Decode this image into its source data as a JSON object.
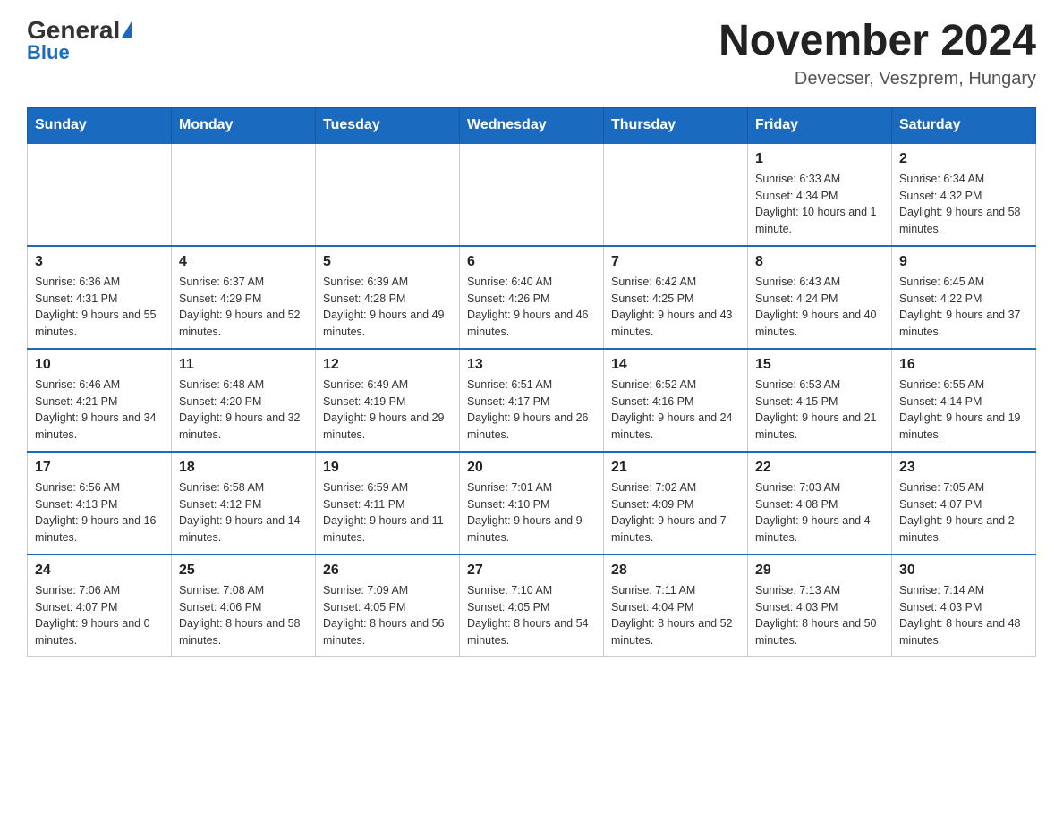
{
  "header": {
    "logo": {
      "general": "General",
      "blue": "Blue"
    },
    "title": "November 2024",
    "location": "Devecser, Veszprem, Hungary"
  },
  "calendar": {
    "days_of_week": [
      "Sunday",
      "Monday",
      "Tuesday",
      "Wednesday",
      "Thursday",
      "Friday",
      "Saturday"
    ],
    "weeks": [
      [
        {
          "day": "",
          "info": ""
        },
        {
          "day": "",
          "info": ""
        },
        {
          "day": "",
          "info": ""
        },
        {
          "day": "",
          "info": ""
        },
        {
          "day": "",
          "info": ""
        },
        {
          "day": "1",
          "info": "Sunrise: 6:33 AM\nSunset: 4:34 PM\nDaylight: 10 hours and 1 minute."
        },
        {
          "day": "2",
          "info": "Sunrise: 6:34 AM\nSunset: 4:32 PM\nDaylight: 9 hours and 58 minutes."
        }
      ],
      [
        {
          "day": "3",
          "info": "Sunrise: 6:36 AM\nSunset: 4:31 PM\nDaylight: 9 hours and 55 minutes."
        },
        {
          "day": "4",
          "info": "Sunrise: 6:37 AM\nSunset: 4:29 PM\nDaylight: 9 hours and 52 minutes."
        },
        {
          "day": "5",
          "info": "Sunrise: 6:39 AM\nSunset: 4:28 PM\nDaylight: 9 hours and 49 minutes."
        },
        {
          "day": "6",
          "info": "Sunrise: 6:40 AM\nSunset: 4:26 PM\nDaylight: 9 hours and 46 minutes."
        },
        {
          "day": "7",
          "info": "Sunrise: 6:42 AM\nSunset: 4:25 PM\nDaylight: 9 hours and 43 minutes."
        },
        {
          "day": "8",
          "info": "Sunrise: 6:43 AM\nSunset: 4:24 PM\nDaylight: 9 hours and 40 minutes."
        },
        {
          "day": "9",
          "info": "Sunrise: 6:45 AM\nSunset: 4:22 PM\nDaylight: 9 hours and 37 minutes."
        }
      ],
      [
        {
          "day": "10",
          "info": "Sunrise: 6:46 AM\nSunset: 4:21 PM\nDaylight: 9 hours and 34 minutes."
        },
        {
          "day": "11",
          "info": "Sunrise: 6:48 AM\nSunset: 4:20 PM\nDaylight: 9 hours and 32 minutes."
        },
        {
          "day": "12",
          "info": "Sunrise: 6:49 AM\nSunset: 4:19 PM\nDaylight: 9 hours and 29 minutes."
        },
        {
          "day": "13",
          "info": "Sunrise: 6:51 AM\nSunset: 4:17 PM\nDaylight: 9 hours and 26 minutes."
        },
        {
          "day": "14",
          "info": "Sunrise: 6:52 AM\nSunset: 4:16 PM\nDaylight: 9 hours and 24 minutes."
        },
        {
          "day": "15",
          "info": "Sunrise: 6:53 AM\nSunset: 4:15 PM\nDaylight: 9 hours and 21 minutes."
        },
        {
          "day": "16",
          "info": "Sunrise: 6:55 AM\nSunset: 4:14 PM\nDaylight: 9 hours and 19 minutes."
        }
      ],
      [
        {
          "day": "17",
          "info": "Sunrise: 6:56 AM\nSunset: 4:13 PM\nDaylight: 9 hours and 16 minutes."
        },
        {
          "day": "18",
          "info": "Sunrise: 6:58 AM\nSunset: 4:12 PM\nDaylight: 9 hours and 14 minutes."
        },
        {
          "day": "19",
          "info": "Sunrise: 6:59 AM\nSunset: 4:11 PM\nDaylight: 9 hours and 11 minutes."
        },
        {
          "day": "20",
          "info": "Sunrise: 7:01 AM\nSunset: 4:10 PM\nDaylight: 9 hours and 9 minutes."
        },
        {
          "day": "21",
          "info": "Sunrise: 7:02 AM\nSunset: 4:09 PM\nDaylight: 9 hours and 7 minutes."
        },
        {
          "day": "22",
          "info": "Sunrise: 7:03 AM\nSunset: 4:08 PM\nDaylight: 9 hours and 4 minutes."
        },
        {
          "day": "23",
          "info": "Sunrise: 7:05 AM\nSunset: 4:07 PM\nDaylight: 9 hours and 2 minutes."
        }
      ],
      [
        {
          "day": "24",
          "info": "Sunrise: 7:06 AM\nSunset: 4:07 PM\nDaylight: 9 hours and 0 minutes."
        },
        {
          "day": "25",
          "info": "Sunrise: 7:08 AM\nSunset: 4:06 PM\nDaylight: 8 hours and 58 minutes."
        },
        {
          "day": "26",
          "info": "Sunrise: 7:09 AM\nSunset: 4:05 PM\nDaylight: 8 hours and 56 minutes."
        },
        {
          "day": "27",
          "info": "Sunrise: 7:10 AM\nSunset: 4:05 PM\nDaylight: 8 hours and 54 minutes."
        },
        {
          "day": "28",
          "info": "Sunrise: 7:11 AM\nSunset: 4:04 PM\nDaylight: 8 hours and 52 minutes."
        },
        {
          "day": "29",
          "info": "Sunrise: 7:13 AM\nSunset: 4:03 PM\nDaylight: 8 hours and 50 minutes."
        },
        {
          "day": "30",
          "info": "Sunrise: 7:14 AM\nSunset: 4:03 PM\nDaylight: 8 hours and 48 minutes."
        }
      ]
    ]
  }
}
